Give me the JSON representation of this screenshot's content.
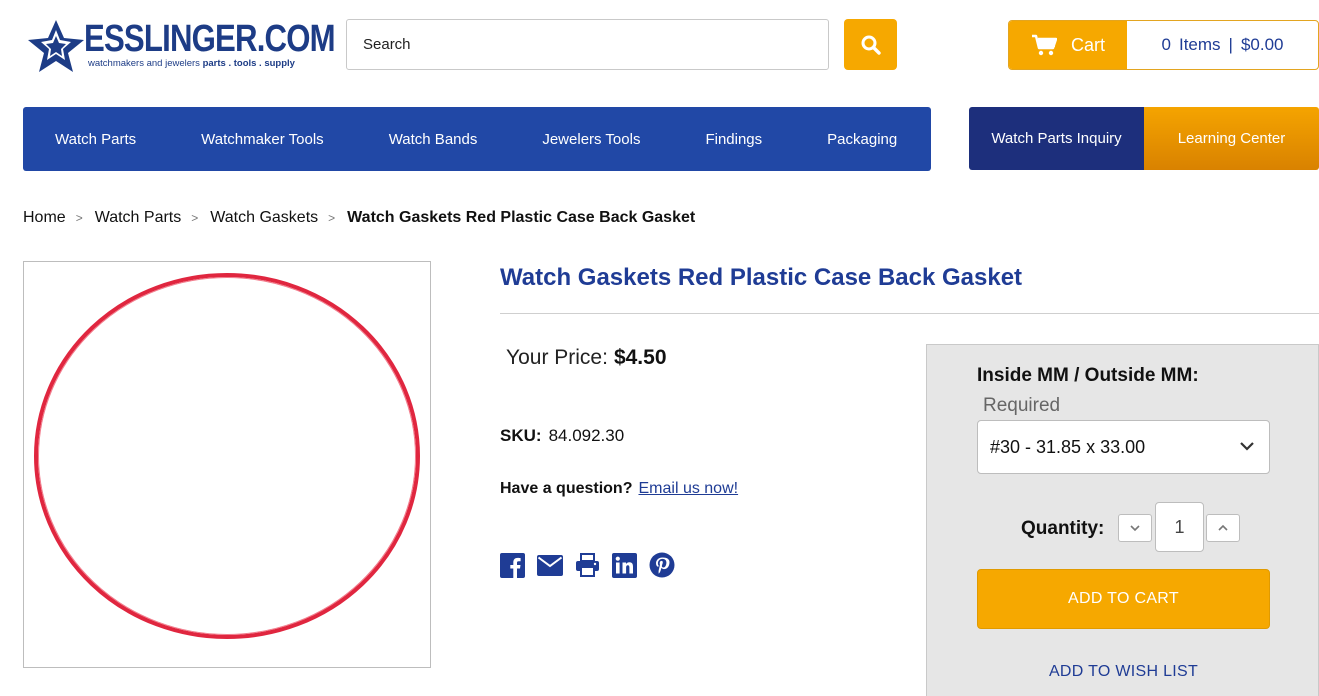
{
  "header": {
    "logo_text": "ESSLINGER.COM",
    "tagline_plain": "watchmakers and jewelers",
    "tagline_bold": "parts . tools . supply",
    "search_placeholder": "Search",
    "cart_label": "Cart",
    "cart_count": "0",
    "cart_items_label": "Items",
    "cart_sep": "|",
    "cart_total": "$0.00"
  },
  "nav": {
    "items": [
      "Watch Parts",
      "Watchmaker Tools",
      "Watch Bands",
      "Jewelers Tools",
      "Findings",
      "Packaging"
    ],
    "inquiry": "Watch Parts Inquiry",
    "learning": "Learning Center"
  },
  "breadcrumb": {
    "items": [
      "Home",
      "Watch Parts",
      "Watch Gaskets"
    ],
    "current": "Watch Gaskets Red Plastic Case Back Gasket",
    "separator": ">"
  },
  "product": {
    "title": "Watch Gaskets Red Plastic Case Back Gasket",
    "price_label": "Your Price:",
    "price": "$4.50",
    "sku_label": "SKU:",
    "sku": "84.092.30",
    "question_label": "Have a question?",
    "question_link": "Email us now!",
    "share_icons": [
      "facebook-icon",
      "email-icon",
      "print-icon",
      "linkedin-icon",
      "pinterest-icon"
    ]
  },
  "options": {
    "label": "Inside MM / Outside MM:",
    "required": "Required",
    "selected": "#30 - 31.85 x 33.00",
    "quantity_label": "Quantity:",
    "quantity": "1",
    "add_to_cart": "ADD TO CART",
    "add_to_wishlist": "ADD TO WISH LIST"
  },
  "colors": {
    "brand_blue": "#2148a6",
    "dark_blue": "#1d2f7c",
    "accent_orange": "#f6a800",
    "title_blue": "#1f3c95",
    "gasket_red": "#e0263f"
  }
}
